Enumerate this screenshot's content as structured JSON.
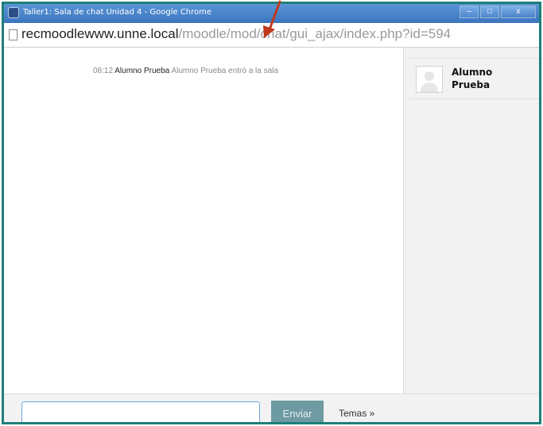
{
  "window": {
    "title": "Taller1: Sala de chat Unidad 4 - Google Chrome",
    "controls": {
      "minimize_glyph": "–",
      "maximize_glyph": "□",
      "close_glyph": "x"
    }
  },
  "address_bar": {
    "host": "recmoodlewww.unne.local",
    "path": "/moodle/mod/chat/gui_ajax/index.php?id=594"
  },
  "chat": {
    "messages": [
      {
        "time": "08:12",
        "user": "Alumno Prueba",
        "text": "Alumno Prueba entró a la sala"
      }
    ]
  },
  "users": [
    {
      "name": "Alumno Prueba"
    }
  ],
  "composer": {
    "input_value": "",
    "send_label": "Enviar",
    "themes_label": "Temas »"
  },
  "colors": {
    "frame_border": "#1e7f78",
    "titlebar": "#4a85cc",
    "send_button": "#6e9aa2",
    "annotation_arrow": "#c0391b"
  },
  "icons": {
    "title_icon": "browser-tab-icon",
    "page_icon": "page-icon",
    "avatar": "default-avatar-icon",
    "annotation": "red-arrow-icon"
  }
}
